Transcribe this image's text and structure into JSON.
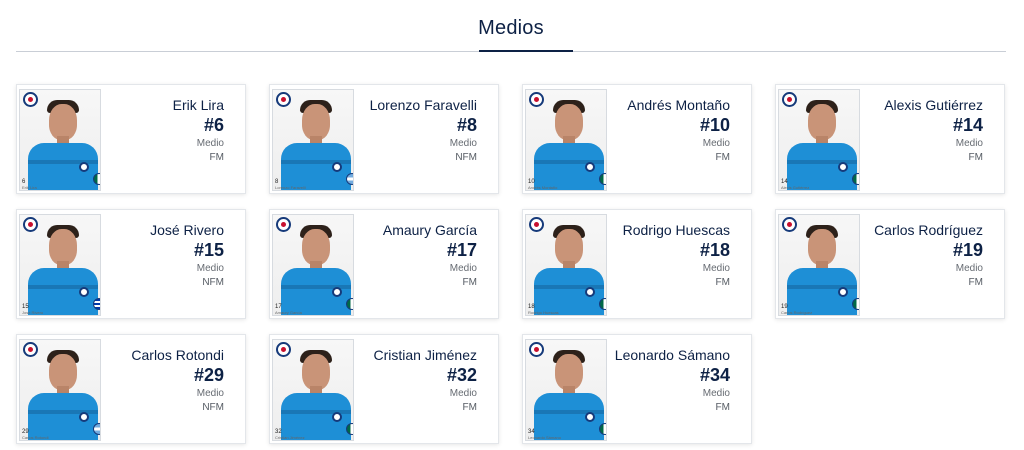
{
  "section": {
    "title": "Medios"
  },
  "players": [
    {
      "name": "Erik Lira",
      "number": "#6",
      "position": "Medio",
      "status": "FM",
      "photo_number": "6",
      "photo_caption": "Erik Lira",
      "flag": "mexico"
    },
    {
      "name": "Lorenzo Faravelli",
      "number": "#8",
      "position": "Medio",
      "status": "NFM",
      "photo_number": "8",
      "photo_caption": "Lorenzo Faravelli",
      "flag": "argentina"
    },
    {
      "name": "Andrés Montaño",
      "number": "#10",
      "position": "Medio",
      "status": "FM",
      "photo_number": "10",
      "photo_caption": "Andrés Montaño",
      "flag": "mexico"
    },
    {
      "name": "Alexis Gutiérrez",
      "number": "#14",
      "position": "Medio",
      "status": "FM",
      "photo_number": "14",
      "photo_caption": "Alexis Gutiérrez",
      "flag": "mexico"
    },
    {
      "name": "José Rivero",
      "number": "#15",
      "position": "Medio",
      "status": "NFM",
      "photo_number": "15",
      "photo_caption": "José Rivero",
      "flag": "uruguay"
    },
    {
      "name": "Amaury García",
      "number": "#17",
      "position": "Medio",
      "status": "FM",
      "photo_number": "17",
      "photo_caption": "Amaury García",
      "flag": "mexico"
    },
    {
      "name": "Rodrigo Huescas",
      "number": "#18",
      "position": "Medio",
      "status": "FM",
      "photo_number": "18",
      "photo_caption": "Rodrigo Huescas",
      "flag": "mexico"
    },
    {
      "name": "Carlos Rodríguez",
      "number": "#19",
      "position": "Medio",
      "status": "FM",
      "photo_number": "19",
      "photo_caption": "Carlos Rodríguez",
      "flag": "mexico"
    },
    {
      "name": "Carlos Rotondi",
      "number": "#29",
      "position": "Medio",
      "status": "NFM",
      "photo_number": "29",
      "photo_caption": "Carlos Rotondi",
      "flag": "argentina"
    },
    {
      "name": "Cristian Jiménez",
      "number": "#32",
      "position": "Medio",
      "status": "FM",
      "photo_number": "32",
      "photo_caption": "Cristian Jiménez",
      "flag": "mexico"
    },
    {
      "name": "Leonardo Sámano",
      "number": "#34",
      "position": "Medio",
      "status": "FM",
      "photo_number": "34",
      "photo_caption": "Leonardo Sámano",
      "flag": "mexico"
    }
  ],
  "colors": {
    "navy": "#0d2145",
    "jersey_blue": "#1e8fd6",
    "crest_blue": "#163a7a"
  }
}
